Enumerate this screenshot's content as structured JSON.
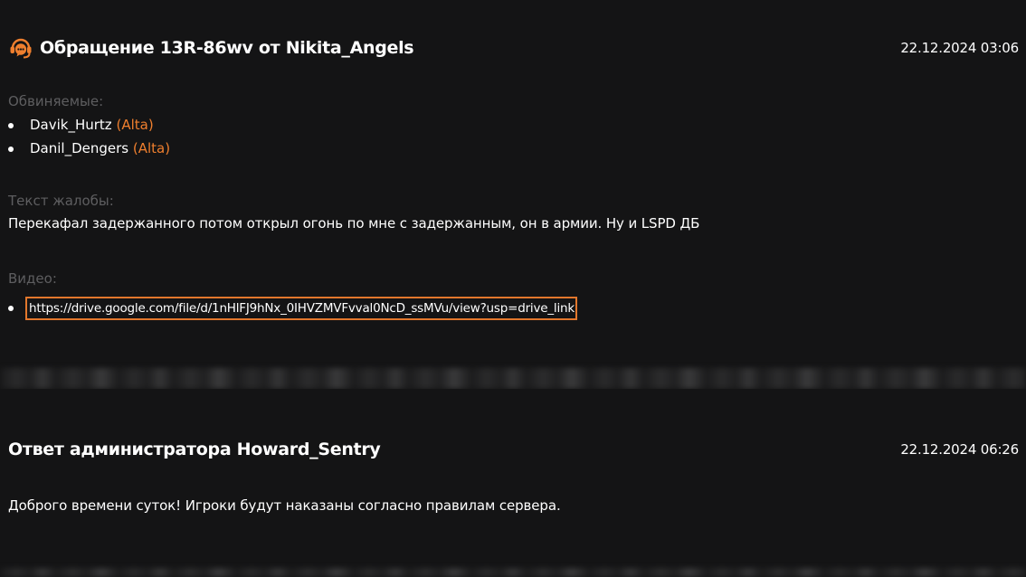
{
  "complaint": {
    "title": "Обращение 13R-86wv от Nikita_Angels",
    "datetime": "22.12.2024 03:06",
    "icon": "headset-chat-icon",
    "accent_color": "#ef7f2e",
    "accused_label": "Обвиняемые:",
    "accused": [
      {
        "name": "Davik_Hurtz",
        "faction": "(Alta)"
      },
      {
        "name": "Danil_Dengers",
        "faction": "(Alta)"
      }
    ],
    "text_label": "Текст жалобы:",
    "text": "Перекафал задержанного потом открыл огонь по мне с задержанным, он в армии. Ну и LSPD ДБ",
    "video_label": "Видео:",
    "videos": [
      "https://drive.google.com/file/d/1nHlFJ9hNx_0IHVZMVFvval0NcD_ssMVu/view?usp=drive_link"
    ]
  },
  "answer": {
    "title": "Ответ администратора Howard_Sentry",
    "datetime": "22.12.2024 06:26",
    "text": "Доброго времени суток! Игроки будут наказаны согласно правилам сервера."
  }
}
